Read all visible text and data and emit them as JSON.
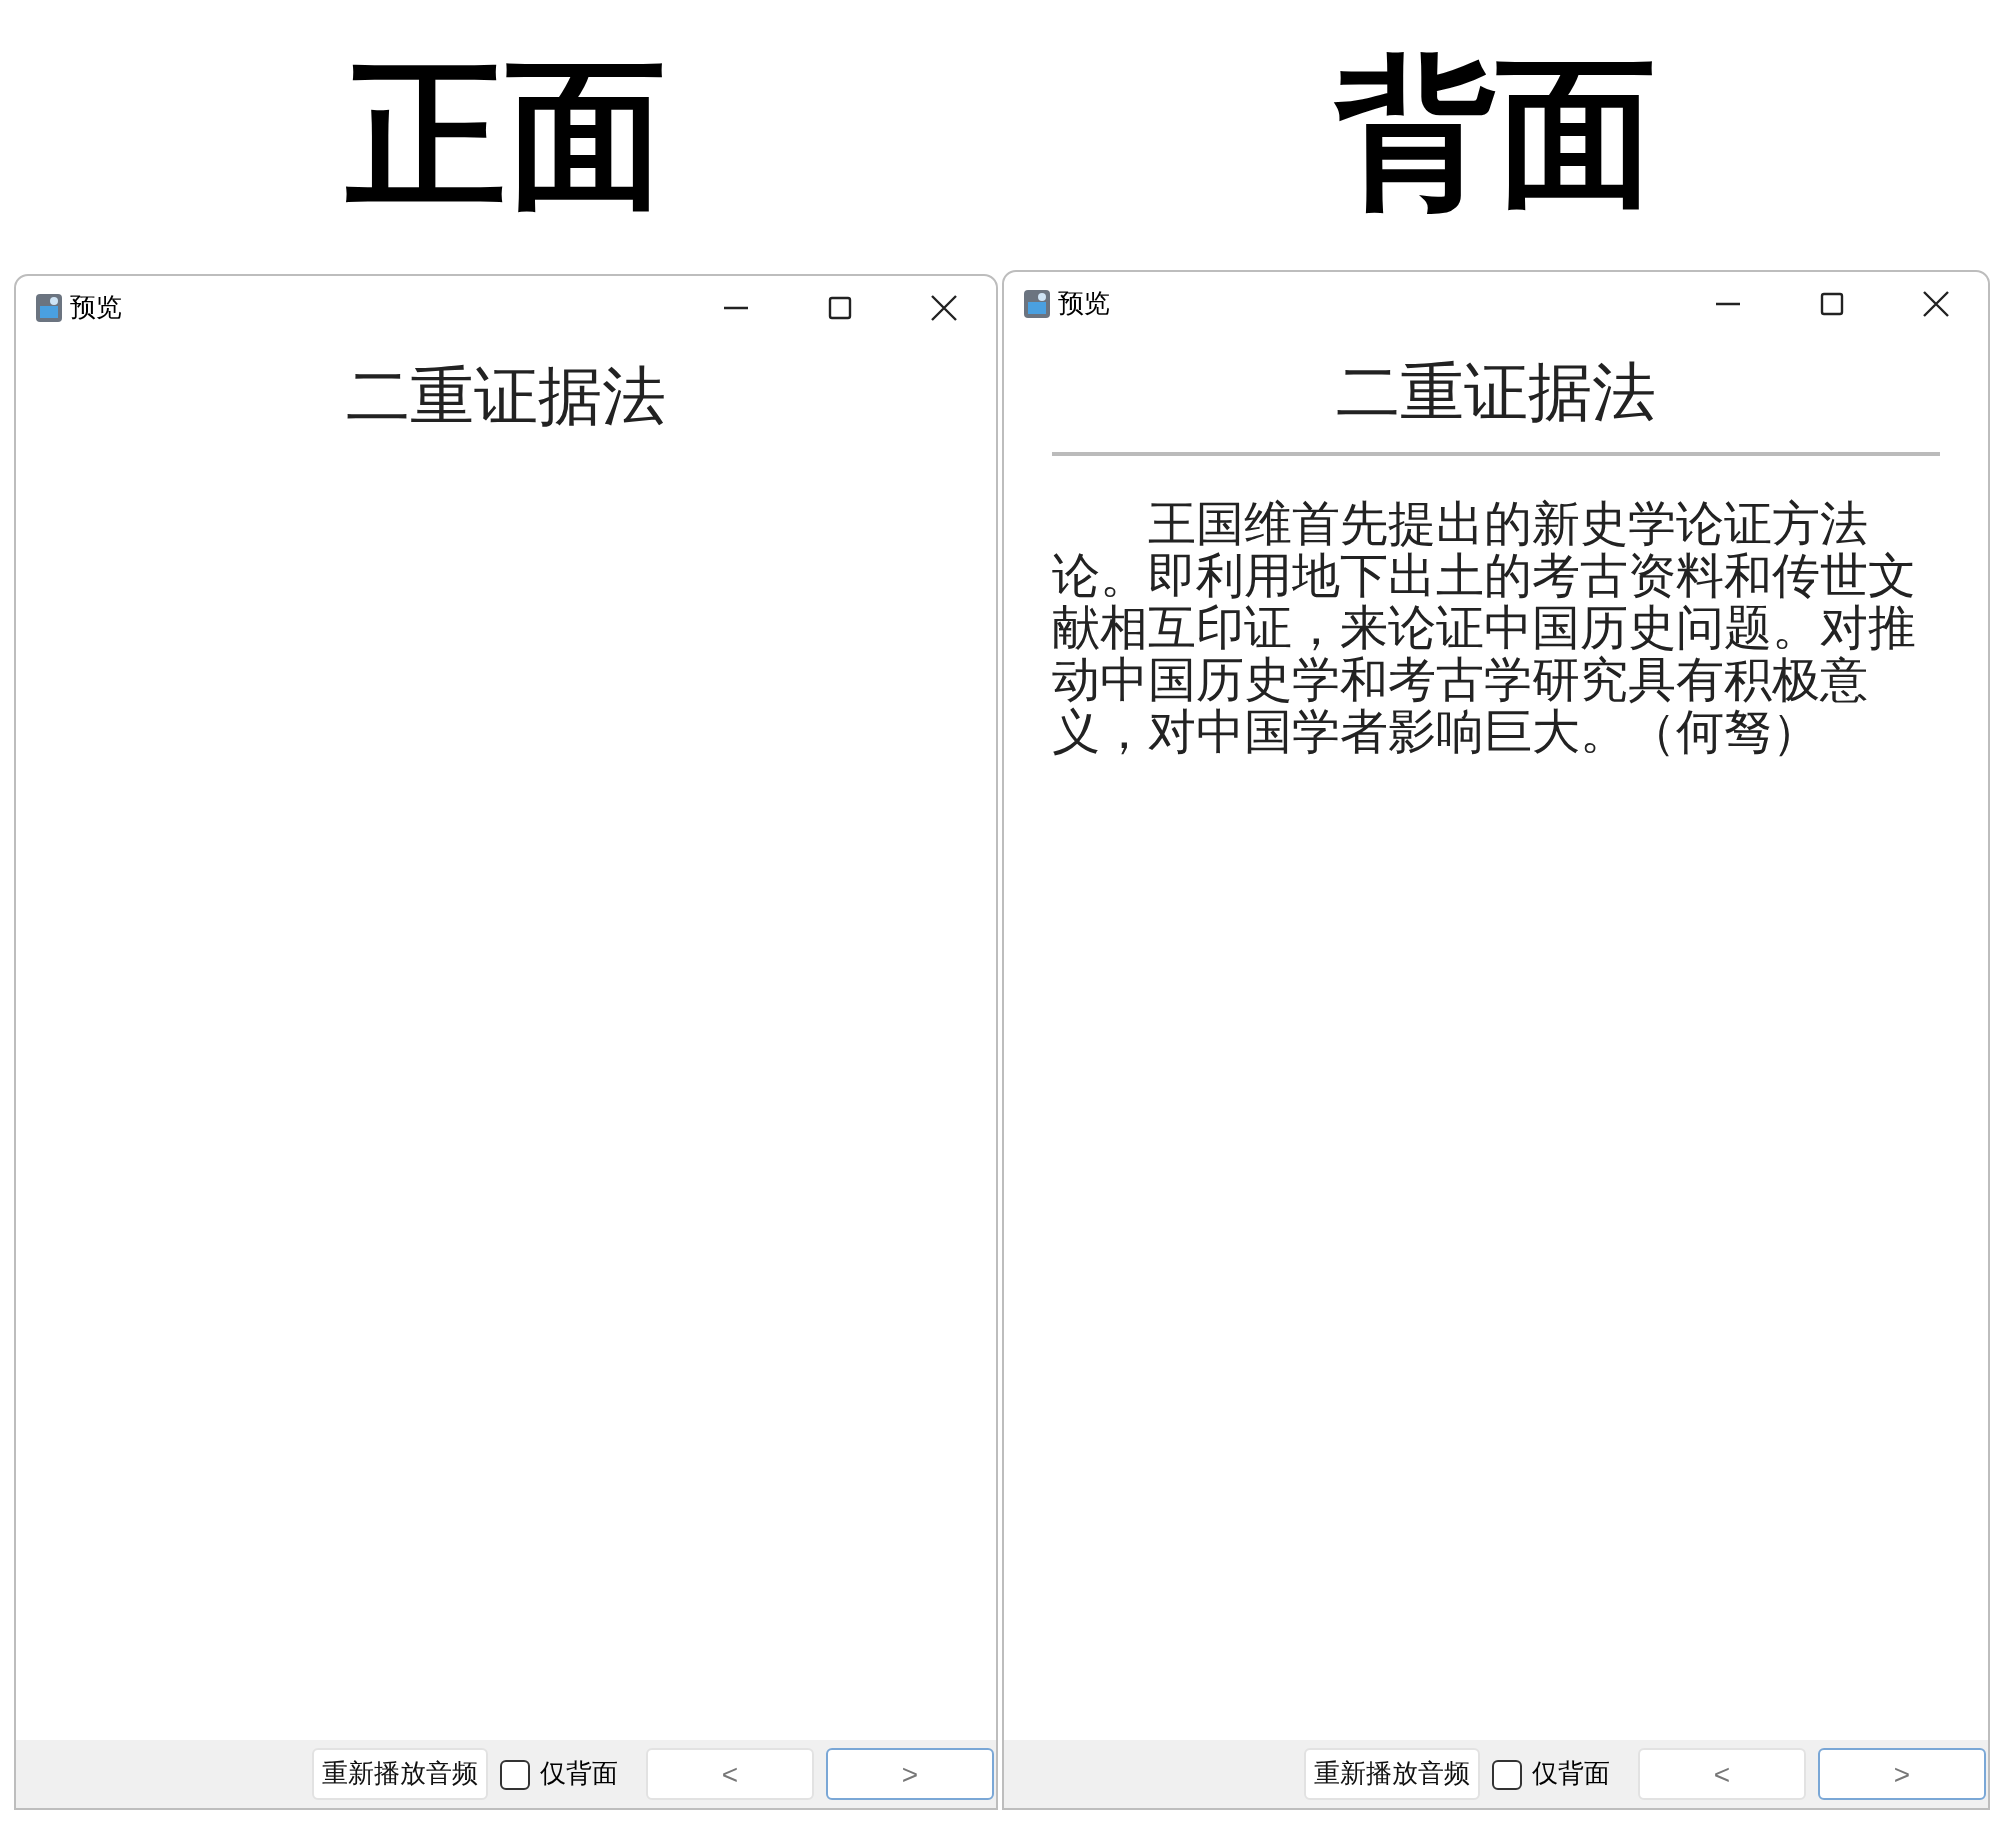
{
  "panels": [
    {
      "heading": "正面",
      "window": {
        "title": "预览",
        "kind": "front",
        "card_title": "二重证据法",
        "toolbar": {
          "replay_button": "重新播放音频",
          "back_only": {
            "label": "仅背面",
            "checked": false
          },
          "prev_button": {
            "label": "<",
            "focused": false
          },
          "next_button": {
            "label": ">",
            "focused": true
          }
        }
      }
    },
    {
      "heading": "背面",
      "window": {
        "title": "预览",
        "kind": "back",
        "card_title": "二重证据法",
        "body": "王国维首先提出的新史学论证方法论。即利用地下出土的考古资料和传世文献相互印证，来论证中国历史问题。对推动中国历史学和考古学研究具有积极意义，对中国学者影响巨大。（何驽）",
        "toolbar": {
          "replay_button": "重新播放音频",
          "back_only": {
            "label": "仅背面",
            "checked": false
          },
          "prev_button": {
            "label": "<",
            "focused": false
          },
          "next_button": {
            "label": ">",
            "focused": true
          }
        }
      }
    }
  ]
}
